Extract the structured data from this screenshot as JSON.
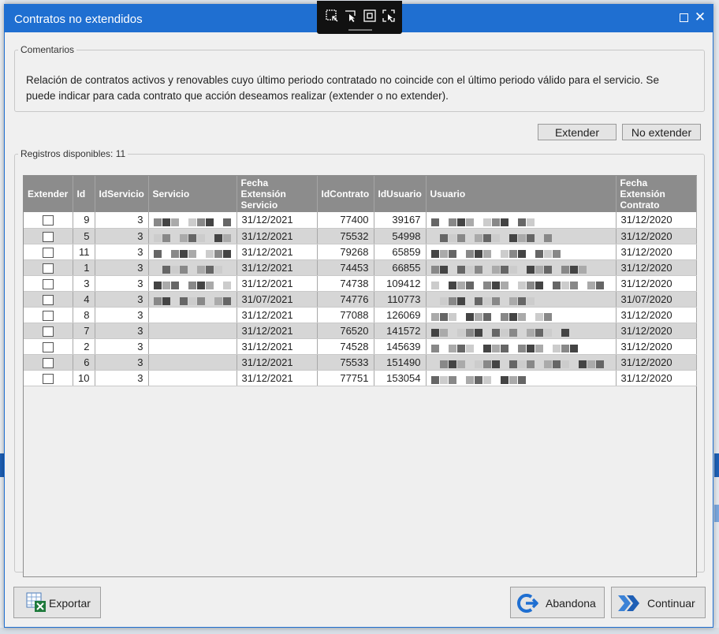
{
  "window": {
    "title": "Contratos no extendidos",
    "accent_color": "#1f6fd1",
    "maximize_icon": "maximize-icon",
    "close_glyph": "✕"
  },
  "comments": {
    "legend": "Comentarios",
    "text": "Relación de contratos activos y renovables cuyo último periodo contratado no coincide con el último periodo válido para el servicio. Se puede indicar para cada contrato que acción deseamos realizar (extender o no extender)."
  },
  "actions": {
    "extender": "Extender",
    "no_extender": "No extender"
  },
  "records": {
    "legend": "Registros disponibles: 11",
    "columns": {
      "extender": "Extender",
      "id": "Id",
      "idservicio": "IdServicio",
      "servicio": "Servicio",
      "fecha_ext_servicio": "Fecha Extensión Servicio",
      "idcontrato": "IdContrato",
      "idusuario": "IdUsuario",
      "usuario": "Usuario",
      "fecha_ext_contrato": "Fecha Extensión Contrato"
    },
    "rows": [
      {
        "id": "9",
        "idservicio": "3",
        "fecha_servicio": "31/12/2021",
        "idcontrato": "77400",
        "idusuario": "39167",
        "fecha_contrato": "31/12/2020"
      },
      {
        "id": "5",
        "idservicio": "3",
        "fecha_servicio": "31/12/2021",
        "idcontrato": "75532",
        "idusuario": "54998",
        "fecha_contrato": "31/12/2020"
      },
      {
        "id": "11",
        "idservicio": "3",
        "fecha_servicio": "31/12/2021",
        "idcontrato": "79268",
        "idusuario": "65859",
        "fecha_contrato": "31/12/2020"
      },
      {
        "id": "1",
        "idservicio": "3",
        "fecha_servicio": "31/12/2021",
        "idcontrato": "74453",
        "idusuario": "66855",
        "fecha_contrato": "31/12/2020"
      },
      {
        "id": "3",
        "idservicio": "3",
        "fecha_servicio": "31/12/2021",
        "idcontrato": "74738",
        "idusuario": "109412",
        "fecha_contrato": "31/12/2020"
      },
      {
        "id": "4",
        "idservicio": "3",
        "fecha_servicio": "31/07/2021",
        "idcontrato": "74776",
        "idusuario": "110773",
        "fecha_contrato": "31/07/2020"
      },
      {
        "id": "8",
        "idservicio": "3",
        "fecha_servicio": "31/12/2021",
        "idcontrato": "77088",
        "idusuario": "126069",
        "fecha_contrato": "31/12/2020"
      },
      {
        "id": "7",
        "idservicio": "3",
        "fecha_servicio": "31/12/2021",
        "idcontrato": "76520",
        "idusuario": "141572",
        "fecha_contrato": "31/12/2020"
      },
      {
        "id": "2",
        "idservicio": "3",
        "fecha_servicio": "31/12/2021",
        "idcontrato": "74528",
        "idusuario": "145639",
        "fecha_contrato": "31/12/2020"
      },
      {
        "id": "6",
        "idservicio": "3",
        "fecha_servicio": "31/12/2021",
        "idcontrato": "75533",
        "idusuario": "151490",
        "fecha_contrato": "31/12/2020"
      },
      {
        "id": "10",
        "idservicio": "3",
        "fecha_servicio": "31/12/2021",
        "idcontrato": "77751",
        "idusuario": "153054",
        "fecha_contrato": "31/12/2020"
      }
    ]
  },
  "footer": {
    "exportar": "Exportar",
    "exportar_icon": "excel-export-icon",
    "abandona": "Abandona",
    "abandona_icon": "exit-arrow-icon",
    "continuar": "Continuar",
    "continuar_icon": "double-chevron-right-icon"
  },
  "snip_toolbar": {
    "icons": [
      "snip-rect-icon",
      "snip-freeform-icon",
      "snip-window-icon",
      "snip-fullscreen-icon"
    ]
  }
}
